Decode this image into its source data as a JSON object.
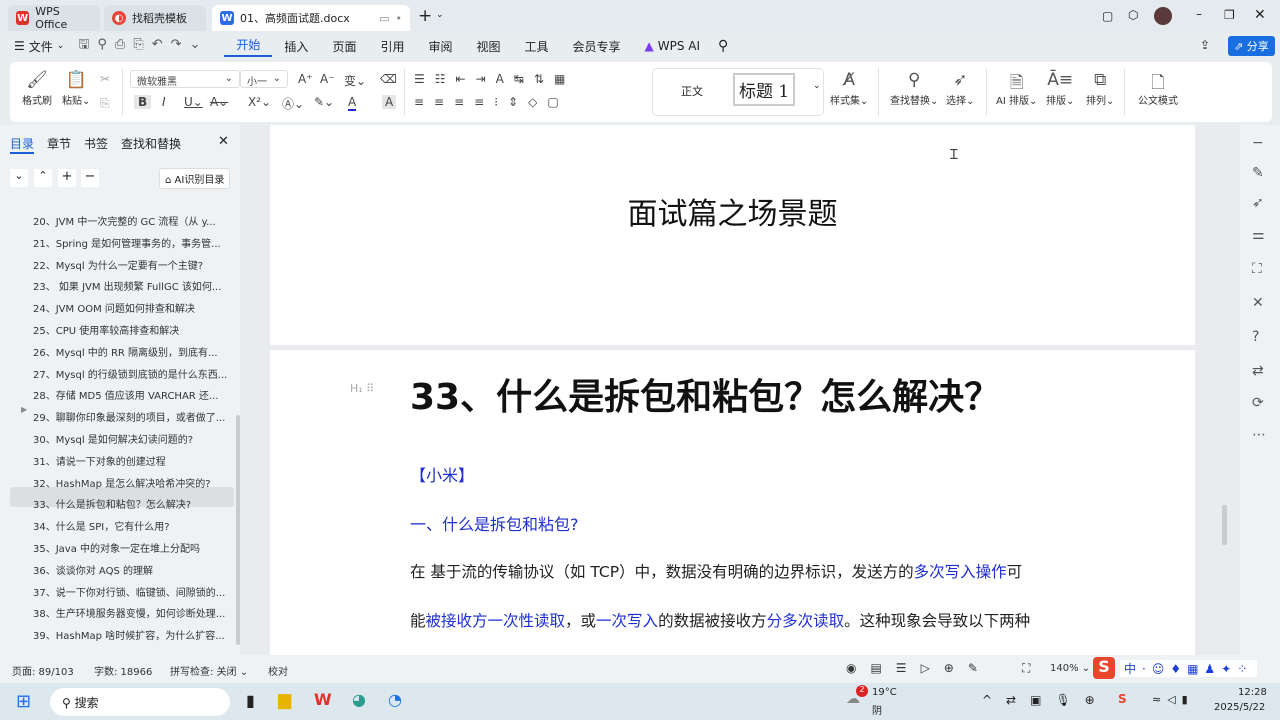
{
  "tabs": [
    {
      "label": "WPS Office"
    },
    {
      "label": "找稻壳模板"
    },
    {
      "label": "01、高频面试题.docx"
    }
  ],
  "menu": {
    "file": "文件",
    "items": [
      "开始",
      "插入",
      "页面",
      "引用",
      "审阅",
      "视图",
      "工具",
      "会员专享"
    ],
    "wps_ai": "WPS AI",
    "share": "分享"
  },
  "ribbon": {
    "format_painter": "格式刷",
    "paste": "粘贴",
    "font_name": "微软雅黑",
    "font_size": "小一",
    "style_normal": "正文",
    "style_h1": "标题 1",
    "style_set": "样式集",
    "find_replace": "查找替换",
    "select": "选择",
    "ai_layout": "AI 排版",
    "layout": "排版",
    "arrange": "排列",
    "official_mode": "公文模式"
  },
  "left_panel": {
    "tabs": [
      "目录",
      "章节",
      "书签",
      "查找和替换"
    ],
    "ai_toc": "AI识别目录",
    "toc": [
      "20、JVM 中一次完整的 GC 流程（从 y...",
      "21、Spring 是如何管理事务的，事务管...",
      "22、Mysql 为什么一定要有一个主键?",
      "23、 如果 JVM 出现频繁 FullGC 该如何...",
      "24、JVM OOM 问题如何排查和解决",
      "25、CPU 使用率较高排查和解决",
      "26、Mysql 中的 RR 隔离级别，到底有...",
      "27、Mysql 的行级锁到底锁的是什么东西...",
      "28、存储 MD5 值应该用 VARCHAR 还...",
      "29、聊聊你印象最深刻的项目，或者做了...",
      "30、Mysql 是如何解决幻读问题的?",
      "31、请说一下对象的创建过程",
      "32、HashMap 是怎么解决哈希冲突的?",
      "33、什么是拆包和粘包？怎么解决?",
      "34、什么是 SPI，它有什么用?",
      "35、Java 中的对象一定在堆上分配吗",
      "36、谈谈你对 AQS 的理解",
      "37、说一下你对行锁、临键锁、间隙锁的...",
      "38、生产环境服务器变慢，如何诊断处理...",
      "39、HashMap 啥时候扩容，为什么扩容..."
    ],
    "selected_index": 13
  },
  "document": {
    "page_title": "面试篇之场景题",
    "heading": "33、什么是拆包和粘包？怎么解决？",
    "tag": "【小米】",
    "subheading": "一、什么是拆包和粘包?",
    "para1": [
      {
        "t": "在 基于流的传输协议（如 TCP）中，数据没有明确的边界标识，发送方的",
        "c": 0
      },
      {
        "t": "多次写入操作",
        "c": 1
      },
      {
        "t": "可",
        "c": 0
      }
    ],
    "para2": [
      {
        "t": "能",
        "c": 0
      },
      {
        "t": "被接收方一次性读取",
        "c": 1
      },
      {
        "t": "，或",
        "c": 0
      },
      {
        "t": "一次写入",
        "c": 1
      },
      {
        "t": "的数据被接收方",
        "c": 0
      },
      {
        "t": "分多次读取",
        "c": 1
      },
      {
        "t": "。这种现象会导致以下两种",
        "c": 0
      }
    ]
  },
  "status": {
    "page": "页面: 89/103",
    "words": "字数: 18966",
    "spell": "拼写检查: 关闭",
    "proof": "校对",
    "zoom": "140%"
  },
  "taskbar": {
    "search": "搜索",
    "weather_temp": "19°C",
    "weather_desc": "阴",
    "weather_badge": "2",
    "time": "12:28",
    "date": "2025/5/22"
  },
  "colors": {
    "accent": "#1a5fd8",
    "link_blue": "#1f2fd1",
    "wps_red": "#e0312b"
  }
}
